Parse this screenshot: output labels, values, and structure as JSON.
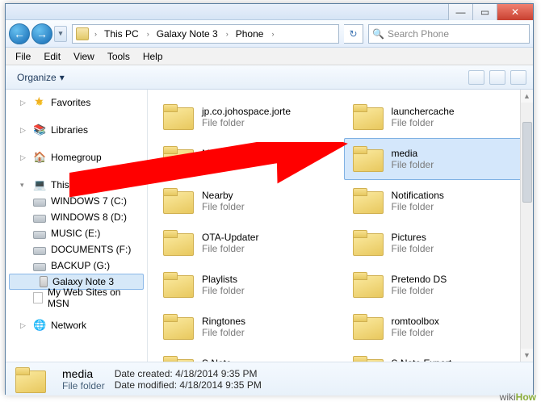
{
  "titlebar": {
    "min": "—",
    "max": "▭",
    "close": "✕"
  },
  "nav": {
    "back": "←",
    "fwd": "→",
    "drop": "▾",
    "refresh": "↻",
    "crumbs": [
      "This PC",
      "Galaxy Note 3",
      "Phone"
    ],
    "sep": "›"
  },
  "search": {
    "placeholder": "Search Phone",
    "icon": "🔍"
  },
  "menu": [
    "File",
    "Edit",
    "View",
    "Tools",
    "Help"
  ],
  "toolbar": {
    "organize": "Organize",
    "drop": "▾"
  },
  "sidebar": {
    "favorites": "Favorites",
    "libraries": "Libraries",
    "homegroup": "Homegroup",
    "thispc": "This PC",
    "drives": [
      "WINDOWS 7 (C:)",
      "WINDOWS 8 (D:)",
      "MUSIC (E:)",
      "DOCUMENTS (F:)",
      "BACKUP (G:)"
    ],
    "phone": "Galaxy Note 3",
    "msn": "My Web Sites on MSN",
    "network": "Network"
  },
  "folders": {
    "left": [
      "jp.co.johospace.jorte",
      "MagicRing",
      "Nearby",
      "OTA-Updater",
      "Playlists",
      "Ringtones",
      "S Note"
    ],
    "right": [
      "launchercache",
      "media",
      "Notifications",
      "Pictures",
      "Pretendo DS",
      "romtoolbox",
      "S Note Export"
    ],
    "type": "File folder"
  },
  "selected_index": 1,
  "details": {
    "name": "media",
    "type": "File folder",
    "created_label": "Date created:",
    "created": "4/18/2014 9:35 PM",
    "modified_label": "Date modified:",
    "modified": "4/18/2014 9:35 PM"
  },
  "watermark": {
    "wiki": "wiki",
    "how": "How"
  }
}
